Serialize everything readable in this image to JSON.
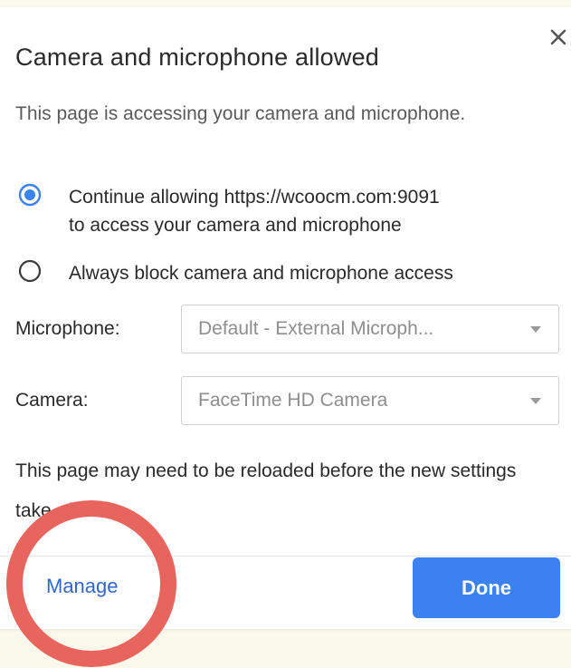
{
  "dialog": {
    "title": "Camera and microphone allowed",
    "close_icon": "close-icon",
    "description": "This page is accessing your camera and microphone.",
    "options": [
      {
        "line1": "Continue allowing https://wcoocm.com:9091",
        "line2": "to access your camera and microphone",
        "selected": true
      },
      {
        "line1": "Always block camera and microphone access",
        "selected": false
      }
    ],
    "microphone": {
      "label": "Microphone:",
      "value": "Default - External Microph..."
    },
    "camera": {
      "label": "Camera:",
      "value": "FaceTime HD Camera"
    },
    "note": "This page may need to be reloaded before the new settings take effect.",
    "manage_label": "Manage",
    "done_label": "Done"
  },
  "colors": {
    "accent": "#3b82f0",
    "link": "#3366cc",
    "highlight": "#e8655e",
    "background": "#fbf8ec"
  }
}
